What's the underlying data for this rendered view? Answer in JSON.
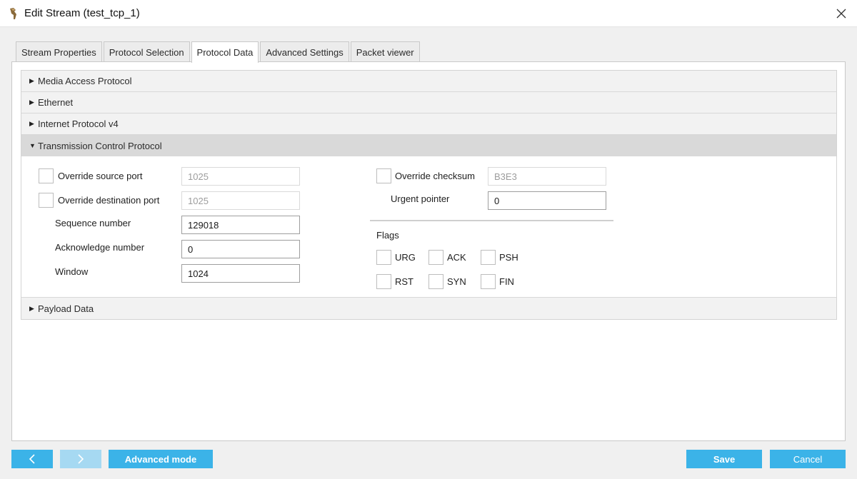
{
  "window": {
    "title": "Edit Stream (test_tcp_1)"
  },
  "tabs": [
    {
      "label": "Stream Properties"
    },
    {
      "label": "Protocol Selection"
    },
    {
      "label": "Protocol Data"
    },
    {
      "label": "Advanced Settings"
    },
    {
      "label": "Packet viewer"
    }
  ],
  "active_tab": "Protocol Data",
  "sections": {
    "mac": "Media Access Protocol",
    "ethernet": "Ethernet",
    "ipv4": "Internet Protocol v4",
    "tcp": "Transmission Control Protocol",
    "payload": "Payload Data"
  },
  "tcp": {
    "override_source_port": {
      "label": "Override source port",
      "value": "1025",
      "checked": false
    },
    "override_destination_port": {
      "label": "Override destination port",
      "value": "1025",
      "checked": false
    },
    "sequence_number": {
      "label": "Sequence number",
      "value": "129018"
    },
    "acknowledge_number": {
      "label": "Acknowledge number",
      "value": "0"
    },
    "window": {
      "label": "Window",
      "value": "1024"
    },
    "override_checksum": {
      "label": "Override checksum",
      "value": "B3E3",
      "checked": false
    },
    "urgent_pointer": {
      "label": "Urgent pointer",
      "value": "0"
    },
    "flags_label": "Flags",
    "flags": {
      "urg": {
        "label": "URG",
        "checked": false
      },
      "ack": {
        "label": "ACK",
        "checked": false
      },
      "psh": {
        "label": "PSH",
        "checked": false
      },
      "rst": {
        "label": "RST",
        "checked": false
      },
      "syn": {
        "label": "SYN",
        "checked": false
      },
      "fin": {
        "label": "FIN",
        "checked": false
      }
    }
  },
  "footer": {
    "back_icon": "chevron-left-icon",
    "next_icon": "chevron-right-icon",
    "advanced_mode": "Advanced mode",
    "save": "Save",
    "cancel": "Cancel"
  },
  "colors": {
    "accent": "#3bb3e8",
    "accent_disabled": "#a6d9f2",
    "section_expanded": "#d9d9d9"
  }
}
